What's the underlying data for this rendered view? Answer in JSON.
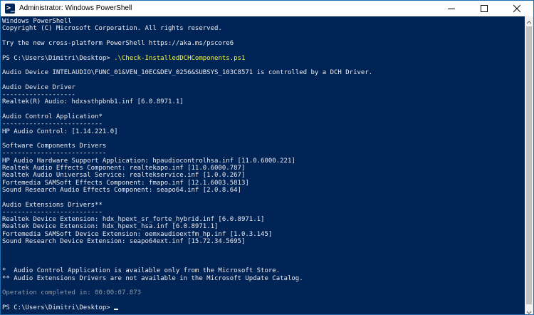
{
  "window": {
    "title": "Administrator: Windows PowerShell"
  },
  "console": {
    "lines": [
      "Windows PowerShell",
      "Copyright (C) Microsoft Corporation. All rights reserved.",
      "",
      "Try the new cross-platform PowerShell https://aka.ms/pscore6",
      "",
      "",
      "",
      "Audio Device INTELAUDIO\\FUNC_01&VEN_10EC&DEV_0256&SUBSYS_103C8571 is controlled by a DCH Driver.",
      "",
      "Audio Device Driver",
      "-------------------",
      "Realtek(R) Audio: hdxssthpbnb1.inf [6.0.8971.1]",
      "",
      "Audio Control Application*",
      "--------------------------",
      "HP Audio Control: [1.14.221.0]",
      "",
      "Software Components Drivers",
      "---------------------------",
      "HP Audio Hardware Support Application: hpaudiocontrolhsa.inf [11.0.6000.221]",
      "Realtek Audio Effects Component: realtekapo.inf [11.0.6000.787]",
      "Realtek Audio Universal Service: realtekservice.inf [1.0.0.267]",
      "Fortemedia SAMSoft Effects Component: fmapo.inf [12.1.6003.5813]",
      "Sound Research Audio Effects Component: seapo64.inf [2.0.8.64]",
      "",
      "Audio Extensions Drivers**",
      "--------------------------",
      "Realtek Device Extension: hdx_hpext_sr_forte_hybrid.inf [6.0.8971.1]",
      "Realtek Device Extension: hdx_hpext_hsa.inf [6.0.8971.1]",
      "Fortemedia SAMSoft Device Extension: oemxaudioextfm_hp.inf [1.0.3.145]",
      "Sound Research Device Extension: seapo64ext.inf [15.72.34.5695]",
      "",
      "",
      "",
      "*  Audio Control Application is available only from the Microsoft Store.",
      "** Audio Extensions Drivers are not available in the Microsoft Update Catalog.",
      "",
      "Operation completed in: 00:00:07.873",
      "",
      "PS C:\\Users\\Dimitri\\Desktop> "
    ],
    "command_prompt": "PS C:\\Users\\Dimitri\\Desktop> ",
    "command_text": ".\\Check-InstalledDCHComponents.ps1"
  },
  "colors": {
    "console_background": "#012456",
    "console_text": "#eeedf0",
    "command_text": "#f5f543",
    "dim_text": "#8d9aa8",
    "titlebar": "#ffffff"
  },
  "icons": {
    "app": "powershell-icon",
    "minimize": "minimize-icon",
    "maximize": "maximize-icon",
    "close": "close-icon",
    "scroll_up": "chevron-up-icon",
    "scroll_down": "chevron-down-icon"
  }
}
